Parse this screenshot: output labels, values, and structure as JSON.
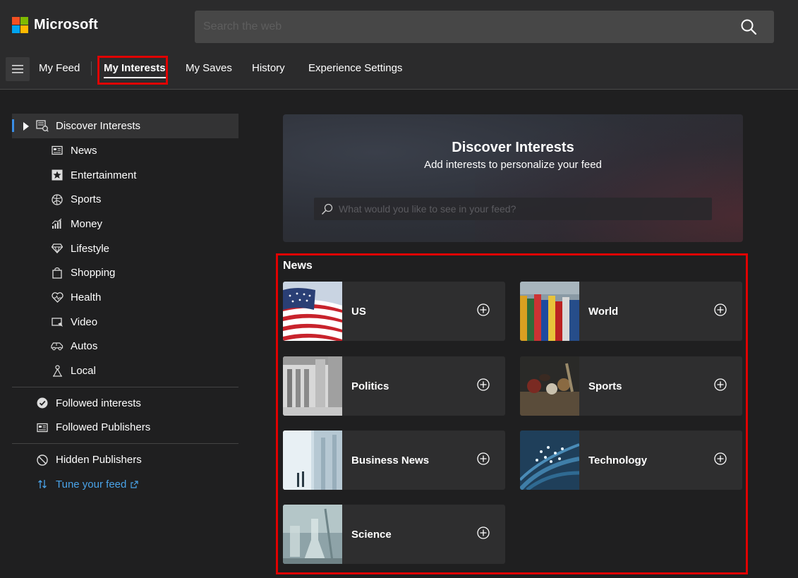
{
  "brand": {
    "name": "Microsoft",
    "colors": [
      "#f25022",
      "#7fba00",
      "#00a4ef",
      "#ffb900"
    ]
  },
  "search": {
    "placeholder": "Search the web",
    "icon": "search-icon"
  },
  "nav": {
    "tabs": [
      {
        "label": "My Feed"
      },
      {
        "label": "My Interests",
        "active": true
      },
      {
        "label": "My Saves"
      },
      {
        "label": "History"
      },
      {
        "label": "Experience Settings"
      }
    ]
  },
  "sidebar": {
    "header": {
      "label": "Discover Interests",
      "icon": "discover-icon"
    },
    "categories": [
      {
        "label": "News",
        "icon": "newspaper-icon"
      },
      {
        "label": "Entertainment",
        "icon": "star-icon"
      },
      {
        "label": "Sports",
        "icon": "ball-icon"
      },
      {
        "label": "Money",
        "icon": "chart-icon"
      },
      {
        "label": "Lifestyle",
        "icon": "diamond-icon"
      },
      {
        "label": "Shopping",
        "icon": "bag-icon"
      },
      {
        "label": "Health",
        "icon": "heart-icon"
      },
      {
        "label": "Video",
        "icon": "video-icon"
      },
      {
        "label": "Autos",
        "icon": "car-icon"
      },
      {
        "label": "Local",
        "icon": "location-icon"
      }
    ],
    "followed_interests": "Followed interests",
    "followed_publishers": "Followed Publishers",
    "hidden_publishers": "Hidden Publishers",
    "tune_feed": "Tune your feed"
  },
  "hero": {
    "title": "Discover Interests",
    "subtitle": "Add interests to personalize your feed",
    "search_placeholder": "What would you like to see in your feed?"
  },
  "news": {
    "title": "News",
    "cards": [
      {
        "label": "US"
      },
      {
        "label": "World"
      },
      {
        "label": "Politics"
      },
      {
        "label": "Sports"
      },
      {
        "label": "Business News"
      },
      {
        "label": "Technology"
      },
      {
        "label": "Science"
      }
    ]
  },
  "colors": {
    "accent": "#3a8ee6",
    "link": "#4aa3e8",
    "highlight": "#e00000"
  }
}
